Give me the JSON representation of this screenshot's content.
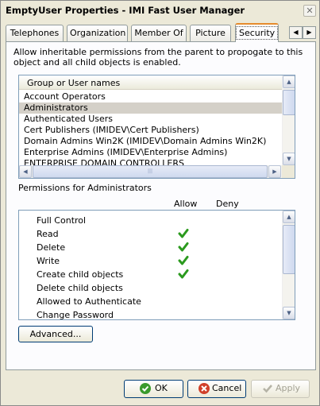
{
  "window": {
    "title": "EmptyUser Properties - IMI Fast User Manager",
    "close_glyph": "✕"
  },
  "tabs": [
    {
      "label": "Telephones"
    },
    {
      "label": "Organization"
    },
    {
      "label": "Member Of"
    },
    {
      "label": "Picture"
    },
    {
      "label": "Security",
      "active": true
    }
  ],
  "tab_scroll": {
    "left_glyph": "◀",
    "right_glyph": "▶"
  },
  "security": {
    "inherit_text": "Allow inheritable permissions from the parent to propogate to this object and all child objects is enabled.",
    "users_header": "Group or User names",
    "users": [
      {
        "name": "Account Operators",
        "selected": false
      },
      {
        "name": "Administrators",
        "selected": true
      },
      {
        "name": "Authenticated Users",
        "selected": false
      },
      {
        "name": "Cert Publishers (IMIDEV\\Cert Publishers)",
        "selected": false
      },
      {
        "name": "Domain Admins Win2K (IMIDEV\\Domain Admins Win2K)",
        "selected": false
      },
      {
        "name": "Enterprise Admins (IMIDEV\\Enterprise Admins)",
        "selected": false
      },
      {
        "name": "ENTERPRISE DOMAIN CONTROLLERS",
        "selected": false
      }
    ],
    "permissions_label": "Permissions for Administrators",
    "allow_header": "Allow",
    "deny_header": "Deny",
    "permissions": [
      {
        "name": "Full Control",
        "allow": false,
        "deny": false
      },
      {
        "name": "Read",
        "allow": true,
        "deny": false
      },
      {
        "name": "Delete",
        "allow": true,
        "deny": false
      },
      {
        "name": "Write",
        "allow": true,
        "deny": false
      },
      {
        "name": "Create child objects",
        "allow": true,
        "deny": false
      },
      {
        "name": "Delete child objects",
        "allow": false,
        "deny": false
      },
      {
        "name": "Allowed to Authenticate",
        "allow": false,
        "deny": false
      },
      {
        "name": "Change Password",
        "allow": false,
        "deny": false
      }
    ],
    "advanced_label": "Advanced..."
  },
  "footer": {
    "ok_label": "OK",
    "cancel_label": "Cancel",
    "apply_label": "Apply"
  },
  "colors": {
    "tab_highlight": "#e68b2c",
    "check_green": "#2b9a1e",
    "ok_icon": "#3a9a2c",
    "cancel_icon": "#d0402a"
  }
}
